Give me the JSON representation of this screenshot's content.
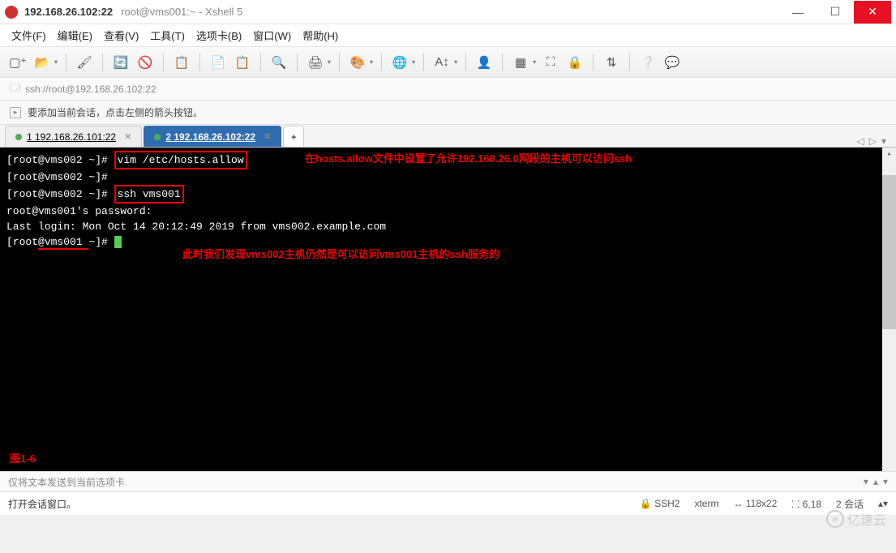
{
  "titlebar": {
    "host": "192.168.26.102:22",
    "rest": "root@vms001:~ - Xshell 5"
  },
  "menubar": {
    "items": [
      "文件(F)",
      "编辑(E)",
      "查看(V)",
      "工具(T)",
      "选项卡(B)",
      "窗口(W)",
      "帮助(H)"
    ]
  },
  "addressbar": {
    "url": "ssh://root@192.168.26.102:22"
  },
  "infobar": {
    "text": "要添加当前会话，点击左侧的箭头按钮。"
  },
  "tabs": {
    "items": [
      {
        "label": "1 192.168.26.101:22",
        "active": false
      },
      {
        "label": "2 192.168.26.102:22",
        "active": true
      }
    ],
    "add": "+"
  },
  "terminal": {
    "line1_prompt": "[root@vms002 ~]# ",
    "line1_cmd": "vim /etc/hosts.allow",
    "annot1": "在hosts.allow文件中设置了允许192.168.26.0网段的主机可以访问ssh",
    "line2_prompt": "[root@vms002 ~]#",
    "line3_prompt": "[root@vms002 ~]# ",
    "line3_cmd": "ssh vms001",
    "line4": "root@vms001's password:",
    "line5": "Last login: Mon Oct 14 20:12:49 2019 from vms002.example.com",
    "line6_a": "[root",
    "line6_b": "@vms001 ",
    "line6_c": "~]# ",
    "annot2": "此时我们发现vms002主机仍然是可以访问vms001主机的ssh服务的",
    "fig": "图1-6"
  },
  "sendbar": {
    "text": "仅将文本发送到当前选项卡"
  },
  "statusbar": {
    "left": "打开会话窗口。",
    "ssh": "SSH2",
    "term": "xterm",
    "size": "118x22",
    "pos": "6,18",
    "sessions": "2 会话"
  },
  "watermark": "亿速云"
}
